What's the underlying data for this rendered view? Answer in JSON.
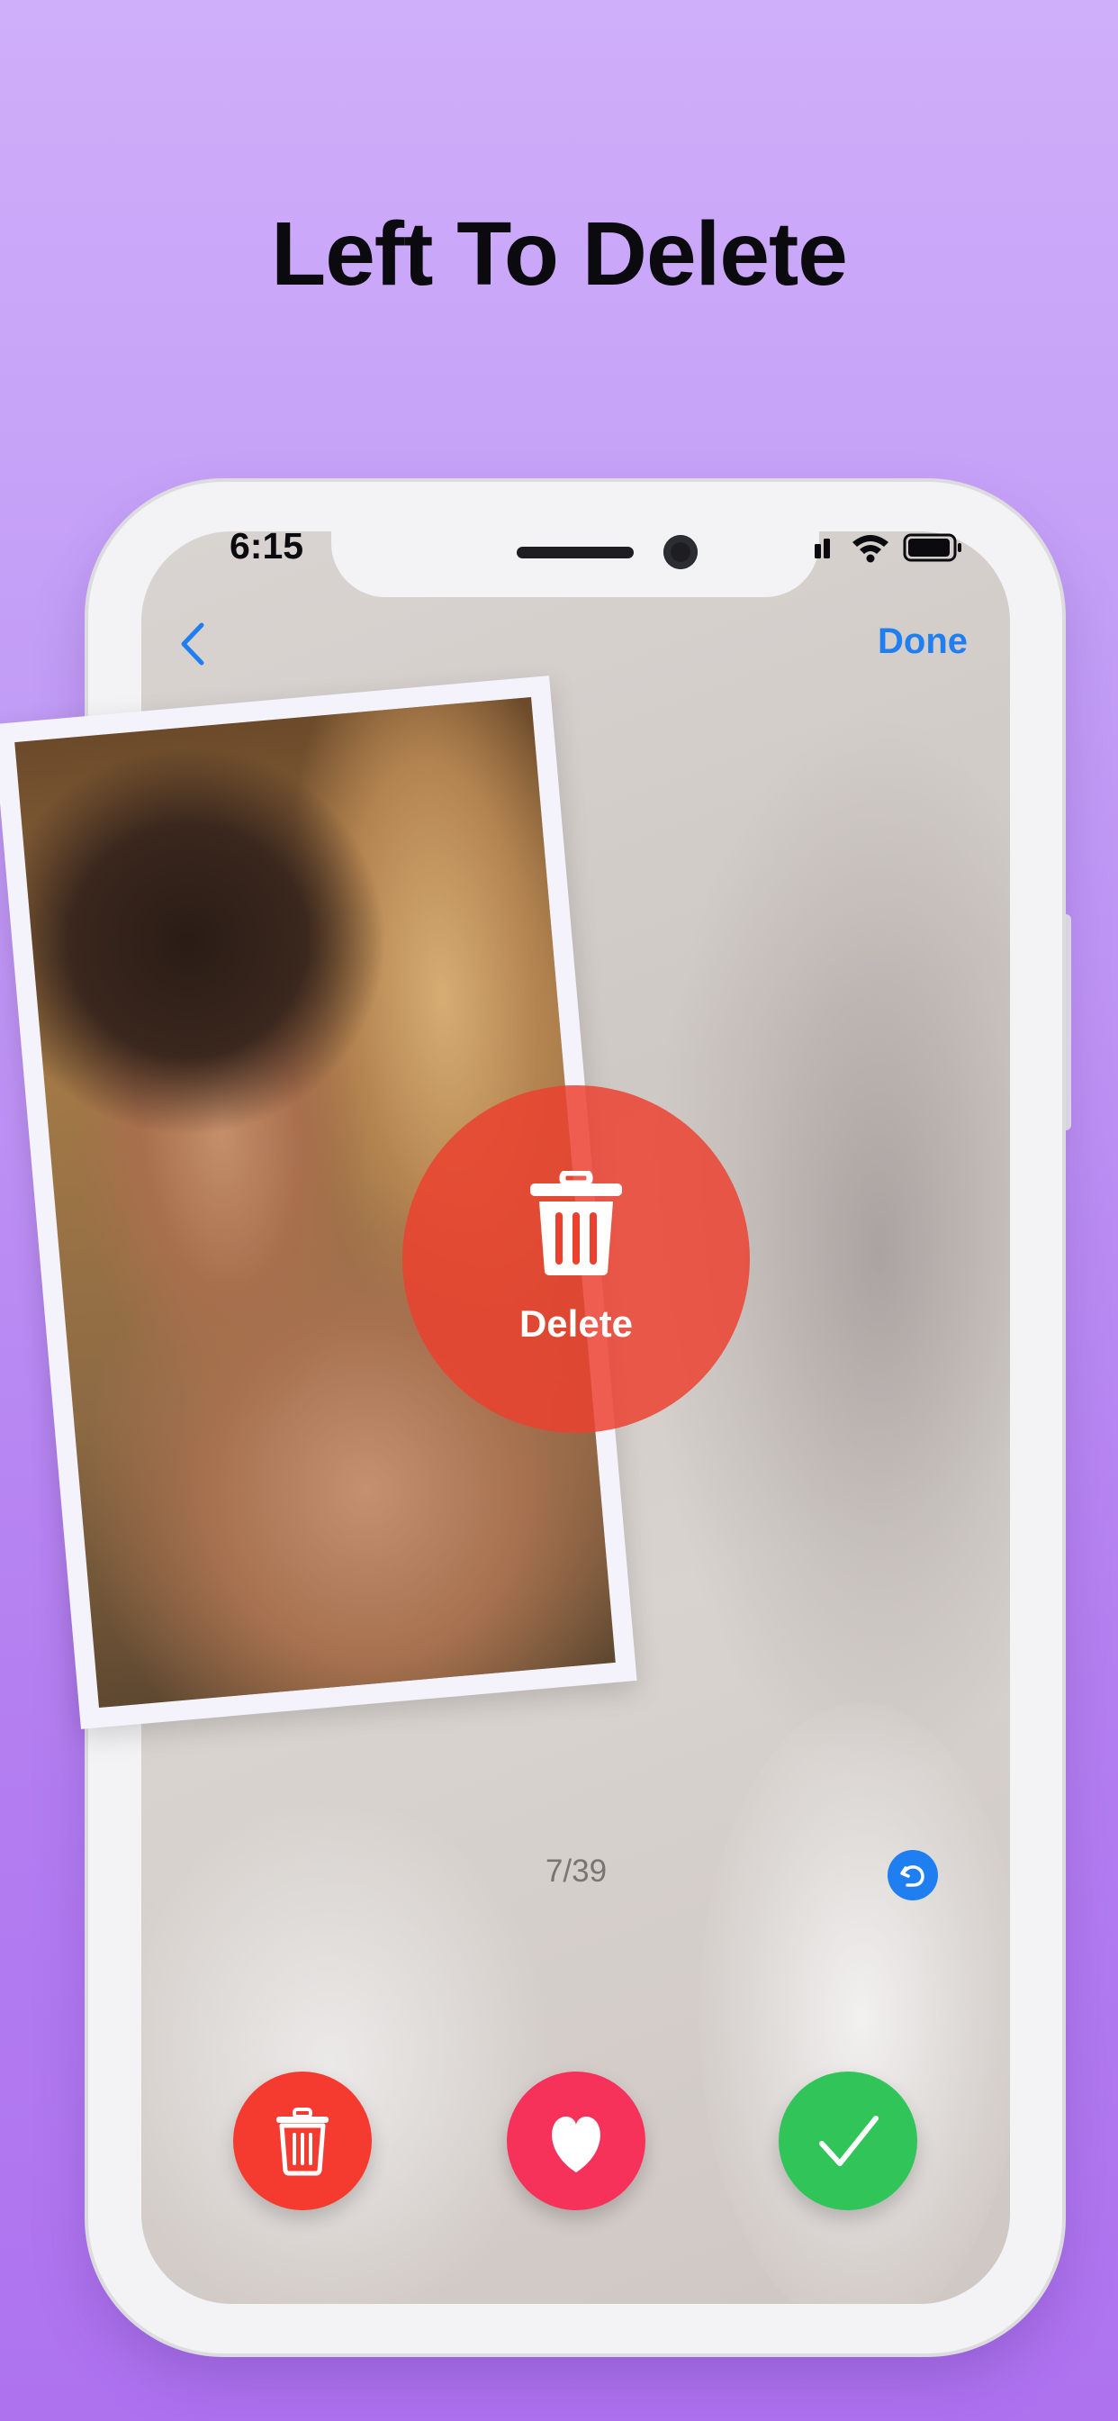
{
  "headline": "Left To Delete",
  "status_bar": {
    "time": "6:15",
    "icons": [
      "cellular-signal-icon",
      "wifi-icon",
      "battery-icon"
    ]
  },
  "nav": {
    "back_icon": "chevron-left-icon",
    "done_label": "Done"
  },
  "swipe_overlay": {
    "label": "Delete",
    "icon": "trash-icon",
    "color": "#ec402e"
  },
  "photo_counter": "7/39",
  "undo_icon": "undo-icon",
  "actions": [
    {
      "name": "delete",
      "icon": "trash-icon",
      "color": "#f53b2f"
    },
    {
      "name": "favorite",
      "icon": "heart-icon",
      "color": "#f7325a"
    },
    {
      "name": "keep",
      "icon": "checkmark-icon",
      "color": "#31c459"
    }
  ],
  "colors": {
    "accent_blue": "#1f7ff0",
    "background_top": "#cfaefa",
    "background_bottom": "#ae72ef"
  }
}
